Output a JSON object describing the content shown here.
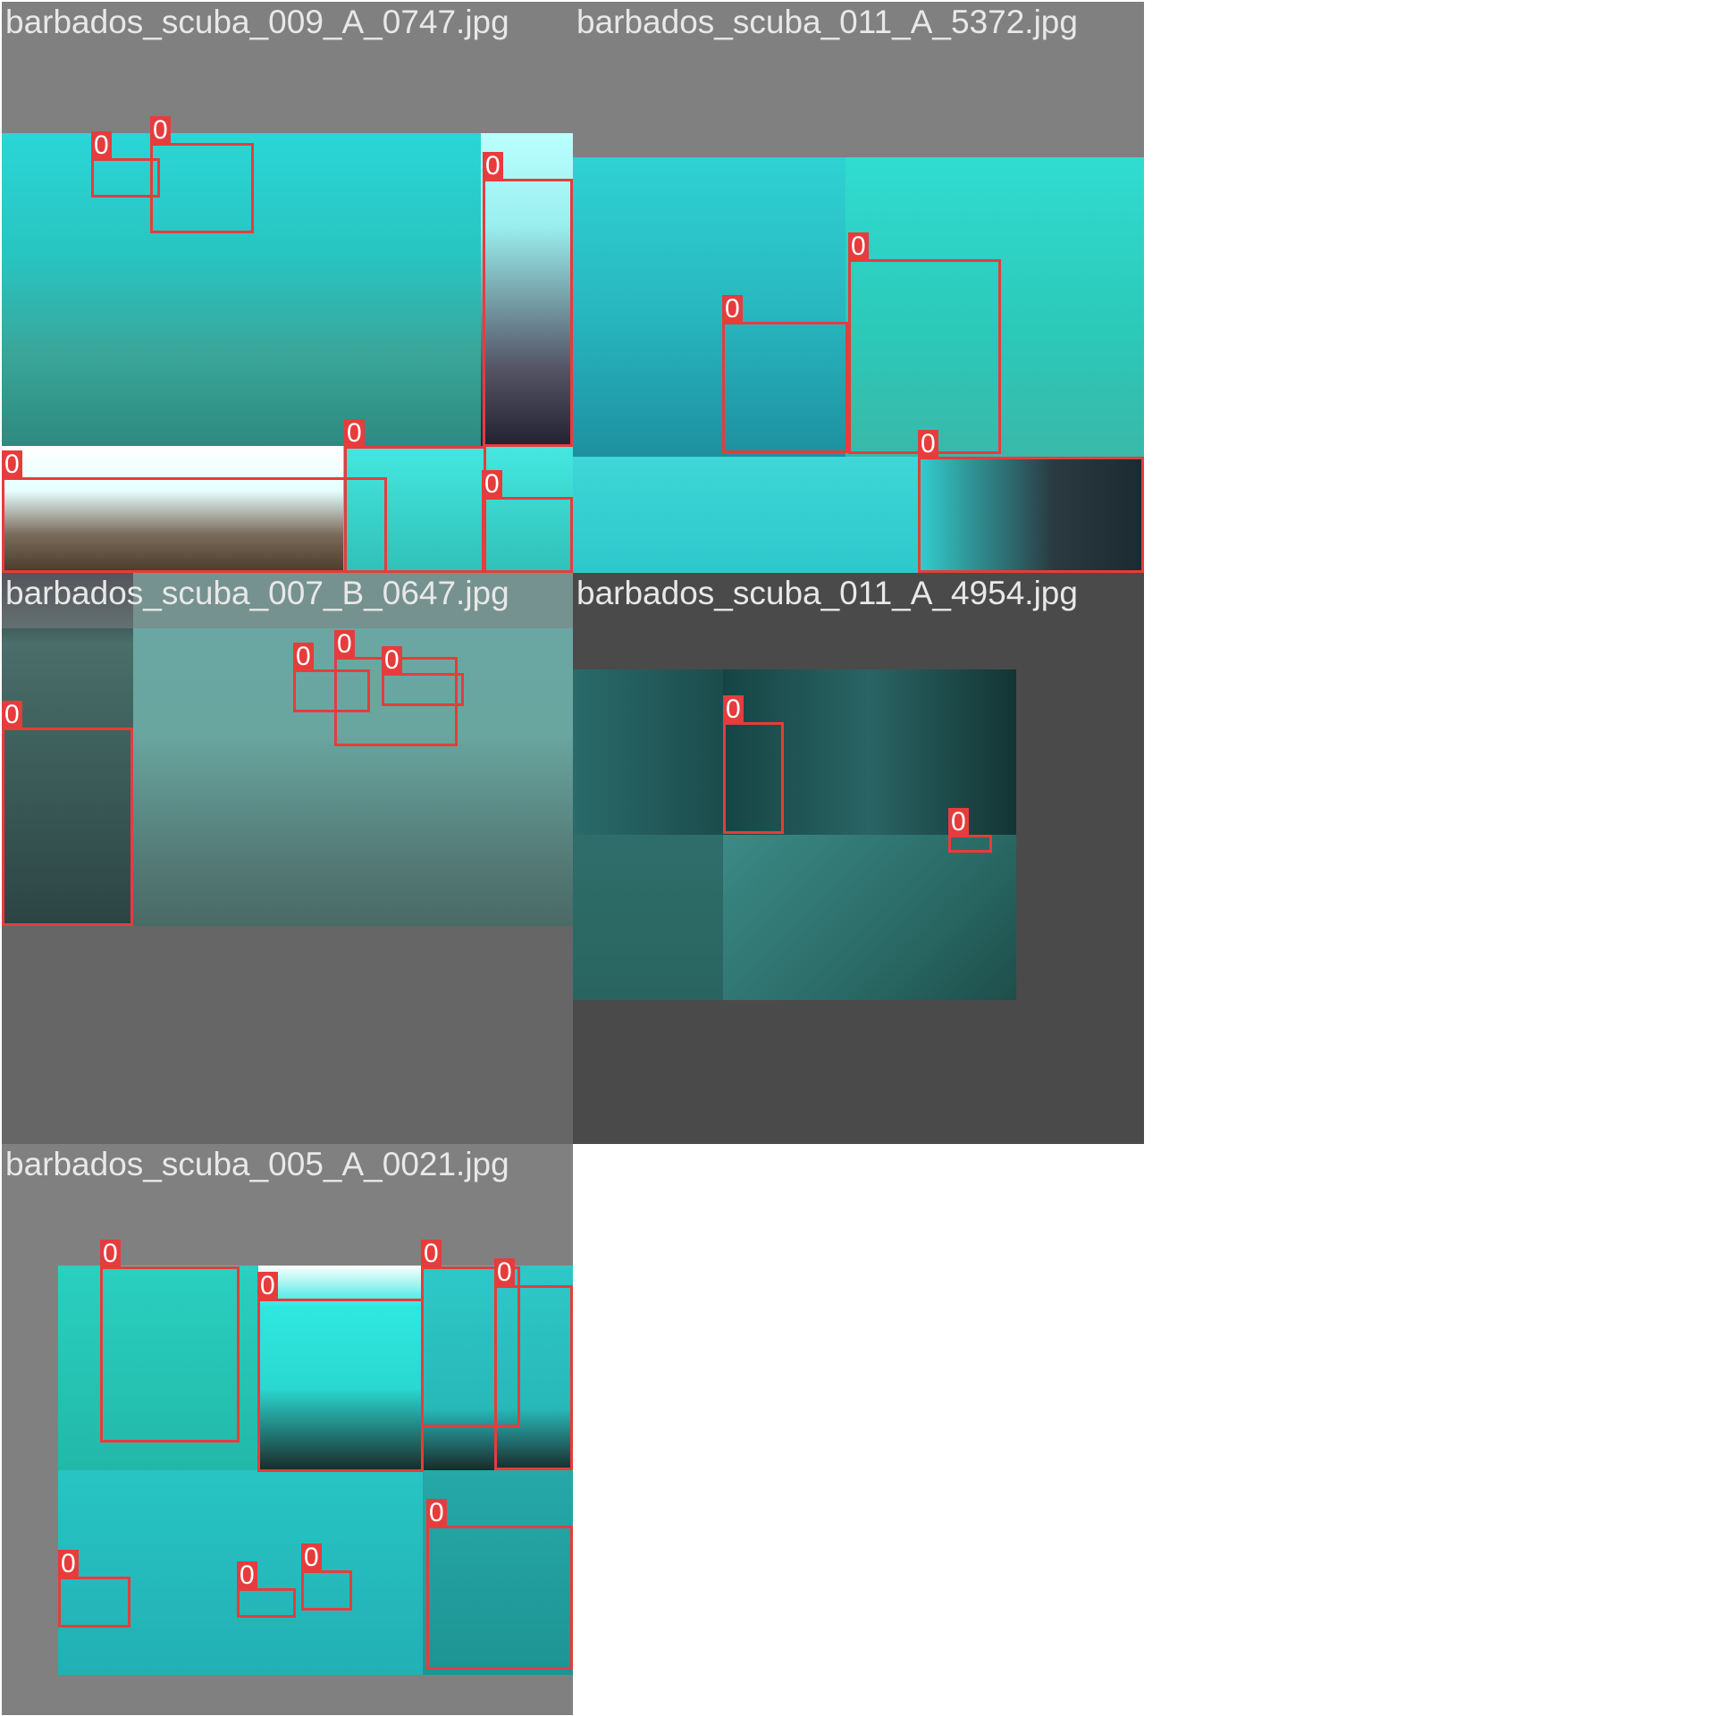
{
  "mosaic": {
    "tiles": [
      {
        "filename": "barbados_scuba_009_A_0747.jpg",
        "boxes": [
          {
            "label": "0"
          },
          {
            "label": "0"
          },
          {
            "label": "0"
          },
          {
            "label": "0"
          },
          {
            "label": "0"
          },
          {
            "label": "0"
          }
        ]
      },
      {
        "filename": "barbados_scuba_011_A_5372.jpg",
        "boxes": [
          {
            "label": "0"
          },
          {
            "label": "0"
          },
          {
            "label": "0"
          }
        ]
      },
      {
        "filename": "barbados_scuba_007_B_0647.jpg",
        "boxes": [
          {
            "label": "0"
          },
          {
            "label": "0"
          },
          {
            "label": "0"
          },
          {
            "label": "0"
          }
        ]
      },
      {
        "filename": "barbados_scuba_011_A_4954.jpg",
        "boxes": [
          {
            "label": "0"
          },
          {
            "label": "0"
          }
        ]
      },
      {
        "filename": "barbados_scuba_005_A_0021.jpg",
        "boxes": [
          {
            "label": "0"
          },
          {
            "label": "0"
          },
          {
            "label": "0"
          },
          {
            "label": "0"
          },
          {
            "label": "0"
          },
          {
            "label": "0"
          },
          {
            "label": "0"
          },
          {
            "label": "0"
          }
        ]
      }
    ]
  },
  "colors": {
    "box": "#e63c3c",
    "pad_gray": "#808080",
    "pad_dark": "#4a4a4a",
    "water": "#22d8d8"
  }
}
